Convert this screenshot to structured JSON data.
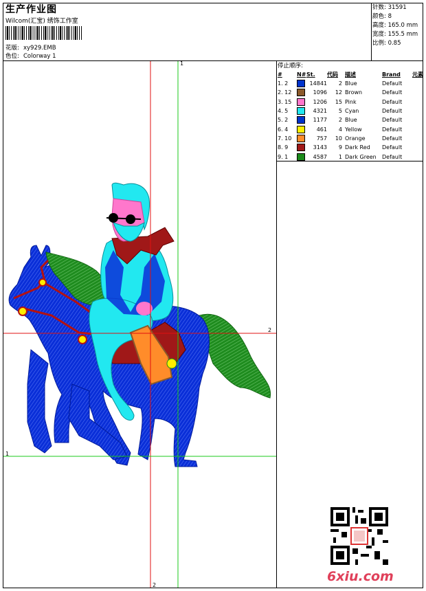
{
  "header": {
    "title": "生产作业图",
    "company": "Wilcom(汇宝) 绣饰工作室",
    "design_label": "花版:",
    "design_value": "xy929.EMB",
    "colorway_label": "色位:",
    "colorway_value": "Colorway 1"
  },
  "stats": {
    "stitches": "针数: 31591",
    "colors": "颜色: 8",
    "height": "高度: 165.0 mm",
    "width": "宽度: 155.5 mm",
    "scale": "比例: 0.85"
  },
  "sequence": {
    "title": "停止顺序:",
    "headers": [
      "#",
      "N#",
      "St.",
      "代码",
      "描述",
      "Brand",
      "元素"
    ],
    "rows": [
      {
        "idx": "1. 2",
        "color": "#0033cc",
        "st": "14841",
        "code": "2",
        "desc": "Blue",
        "brand": "Default"
      },
      {
        "idx": "2. 12",
        "color": "#8b5a2b",
        "st": "1096",
        "code": "12",
        "desc": "Brown",
        "brand": "Default"
      },
      {
        "idx": "3. 15",
        "color": "#ff77cc",
        "st": "1206",
        "code": "15",
        "desc": "Pink",
        "brand": "Default"
      },
      {
        "idx": "4. 5",
        "color": "#22e8f0",
        "st": "4321",
        "code": "5",
        "desc": "Cyan",
        "brand": "Default"
      },
      {
        "idx": "5. 2",
        "color": "#0033cc",
        "st": "1177",
        "code": "2",
        "desc": "Blue",
        "brand": "Default"
      },
      {
        "idx": "6. 4",
        "color": "#ffee00",
        "st": "461",
        "code": "4",
        "desc": "Yellow",
        "brand": "Default"
      },
      {
        "idx": "7. 10",
        "color": "#ff8c2a",
        "st": "757",
        "code": "10",
        "desc": "Orange",
        "brand": "Default"
      },
      {
        "idx": "8. 9",
        "color": "#a01818",
        "st": "3143",
        "code": "9",
        "desc": "Dark Red",
        "brand": "Default"
      },
      {
        "idx": "9. 1",
        "color": "#1a8a1a",
        "st": "4587",
        "code": "1",
        "desc": "Dark Green",
        "brand": "Default"
      }
    ]
  },
  "guides": {
    "label_top": "1",
    "label_right": "2",
    "label_left": "1",
    "label_bottom": "2"
  },
  "footer": {
    "site": "6xiu.com"
  }
}
